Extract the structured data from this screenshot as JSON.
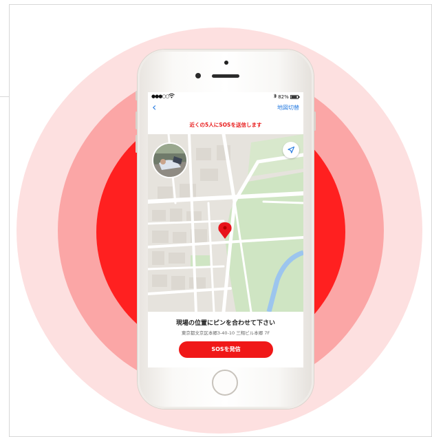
{
  "colors": {
    "ring_outer": "#fde0e0",
    "ring_middle": "#fba6a6",
    "ring_inner": "#ff2020",
    "accent_blue": "#2a7de1",
    "sos_red": "#f01818"
  },
  "status_bar": {
    "signal": "●●●○○",
    "battery": "82%"
  },
  "nav": {
    "back_icon": "chevron-left-icon",
    "back_glyph": "‹",
    "switch_label": "地図切替"
  },
  "notice": "近くの5人にSOSを送信します",
  "map": {
    "pin_icon": "map-pin-icon",
    "locate_icon": "location-arrow-icon"
  },
  "bottom": {
    "title": "現場の位置にピンを合わせて下さい",
    "address": "東京都文京区本郷3-40-10 三翔ビル本郷 7F",
    "sos_label": "SOSを発信"
  }
}
